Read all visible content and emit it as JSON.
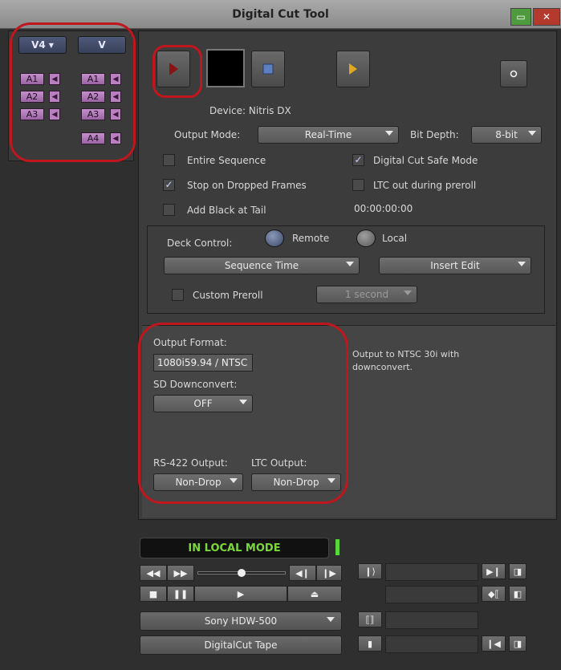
{
  "window": {
    "title": "Digital Cut Tool"
  },
  "tracks": {
    "record_video": "V4",
    "source_video": "V",
    "source_audio": [
      "A1",
      "A2",
      "A3"
    ],
    "record_audio": [
      "A1",
      "A2",
      "A3",
      "A4"
    ]
  },
  "device": {
    "label": "Device: Nitris DX"
  },
  "output_mode": {
    "label": "Output Mode:",
    "value": "Real-Time"
  },
  "bit_depth": {
    "label": "Bit Depth:",
    "value": "8-bit"
  },
  "options": {
    "entire_sequence": {
      "label": "Entire Sequence",
      "checked": false
    },
    "digital_cut_safe_mode": {
      "label": "Digital Cut Safe Mode",
      "checked": true
    },
    "stop_on_dropped_frames": {
      "label": "Stop on Dropped Frames",
      "checked": true
    },
    "ltc_out_during_preroll": {
      "label": "LTC out during preroll",
      "checked": false
    },
    "add_black_at_tail": {
      "label": "Add Black at Tail",
      "checked": false
    },
    "black_timecode": "00:00:00:00"
  },
  "deck": {
    "label": "Deck Control:",
    "remote_label": "Remote",
    "local_label": "Local",
    "time_source": "Sequence Time",
    "edit_mode": "Insert Edit",
    "custom_preroll_label": "Custom Preroll",
    "preroll_value": "1 second"
  },
  "output": {
    "format_label": "Output Format:",
    "format_value": "1080i59.94 / NTSC",
    "description": "Output to NTSC 30i with downconvert.",
    "downconvert_label": "SD Downconvert:",
    "downconvert_value": "OFF",
    "rs422_label": "RS-422 Output:",
    "rs422_value": "Non-Drop",
    "ltc_label": "LTC Output:",
    "ltc_value": "Non-Drop"
  },
  "transport": {
    "status": "IN LOCAL MODE",
    "deck_name": "Sony HDW-500",
    "tape_name": "DigitalCut Tape"
  },
  "colors": {
    "annotation": "#c0161d",
    "status_green": "#7bd83a",
    "track_purple": "#b97fc0"
  }
}
